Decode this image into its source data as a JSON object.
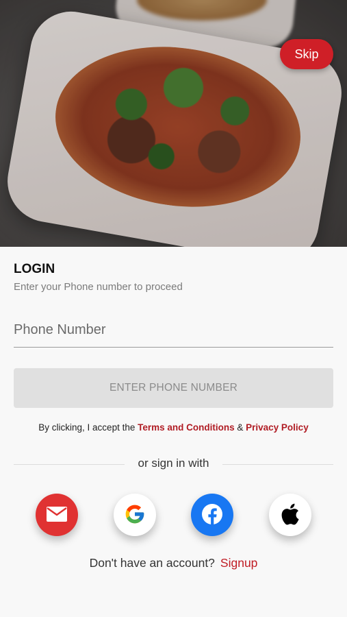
{
  "header": {
    "skip_label": "Skip"
  },
  "login": {
    "title": "LOGIN",
    "subtitle": "Enter your Phone number to proceed",
    "phone_placeholder": "Phone Number",
    "submit_label": "ENTER PHONE NUMBER"
  },
  "terms": {
    "prefix": "By clicking, I accept the ",
    "terms_link": "Terms and Conditions",
    "joiner": " & ",
    "privacy_link": "Privacy Policy"
  },
  "divider": {
    "label": "or sign in with"
  },
  "social": [
    {
      "name": "email",
      "icon": "mail-icon",
      "color": "#e03232"
    },
    {
      "name": "google",
      "icon": "google-icon",
      "color": "#ffffff"
    },
    {
      "name": "facebook",
      "icon": "facebook-icon",
      "color": "#1877f2"
    },
    {
      "name": "apple",
      "icon": "apple-icon",
      "color": "#ffffff"
    }
  ],
  "footer": {
    "question": "Don't have an account?",
    "signup_label": "Signup"
  },
  "colors": {
    "brand": "#cf1f27",
    "link": "#b01c24"
  }
}
